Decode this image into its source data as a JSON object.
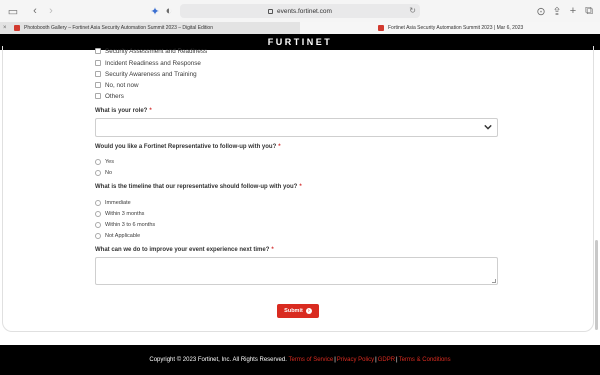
{
  "browser": {
    "url": "events.fortinet.com",
    "tabs": [
      {
        "title": "Photobooth Gallery – Fortinet Asia Security Automation Summit 2023 – Digital Edition",
        "active": false
      },
      {
        "title": "Fortinet Asia Security Automation Summit 2023 | Mar 6, 2023",
        "active": true
      }
    ]
  },
  "header": {
    "logo": "FURTINET"
  },
  "form": {
    "interests": [
      "Security Assessment and Readiness",
      "Incident Readiness and Response",
      "Security Awareness and Training",
      "No, not now",
      "Others"
    ],
    "role_question": "What is your role?",
    "followup_question": "Would you like a Fortinet Representative to follow-up with you?",
    "followup_options": [
      "Yes",
      "No"
    ],
    "timeline_question": "What is the timeline that our representative should follow-up with you?",
    "timeline_options": [
      "Immediate",
      "Within 3 months",
      "Within 3 to 6 months",
      "Not Applicable"
    ],
    "improve_question": "What can we do to improve your event experience next time?",
    "required_mark": "*",
    "submit_label": "Submit"
  },
  "footer": {
    "copyright": "Copyright © 2023 Fortinet, Inc. All Rights Reserved.",
    "links": [
      "Terms of Service",
      "Privacy Policy",
      "GDPR",
      "Terms & Conditions"
    ],
    "separator": "|"
  },
  "colors": {
    "accent": "#d92b20",
    "header_bg": "#000000"
  }
}
